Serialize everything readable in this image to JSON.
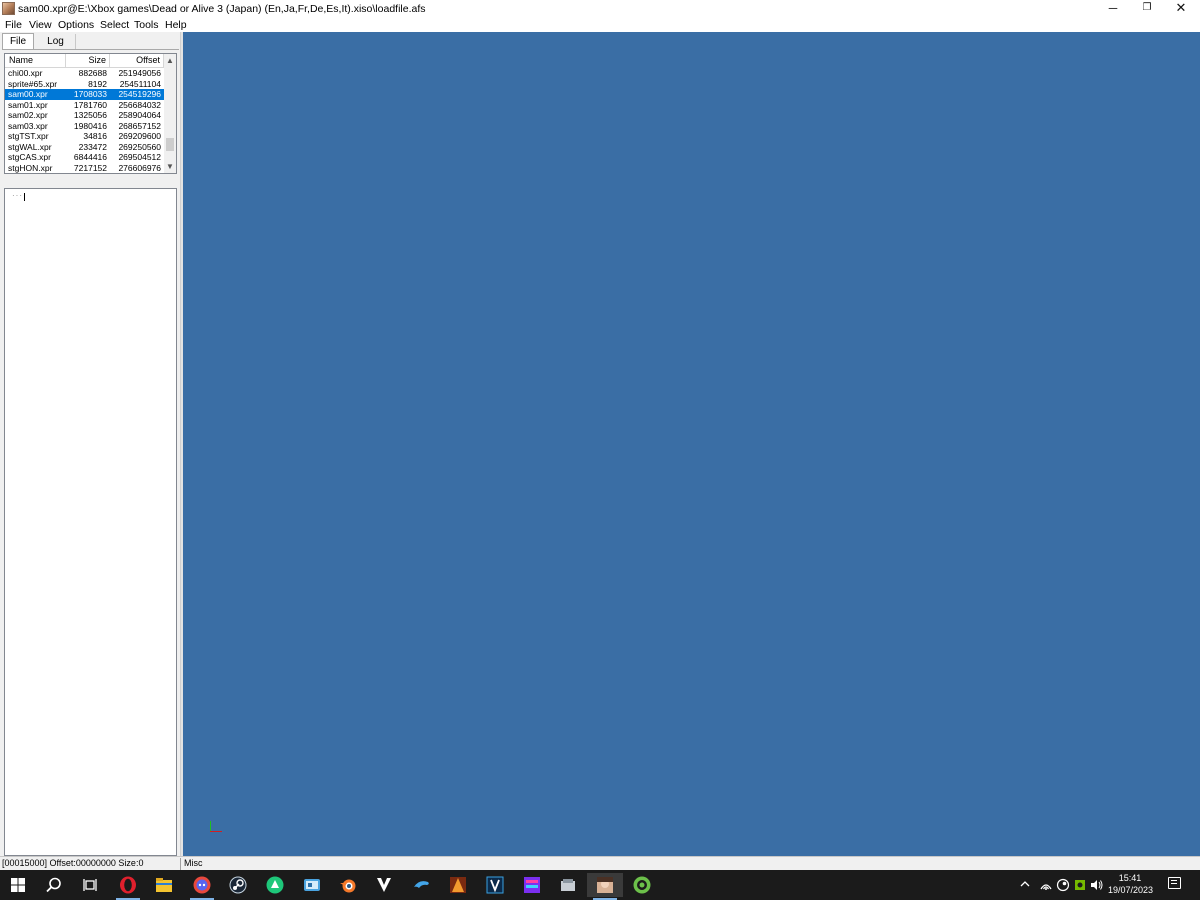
{
  "window": {
    "title": "sam00.xpr@E:\\Xbox games\\Dead or Alive 3 (Japan) (En,Ja,Fr,De,Es,It).xiso\\loadfile.afs",
    "minimize_glyph": "─",
    "maximize_glyph": "❐",
    "close_glyph": "✕"
  },
  "menu": [
    "File",
    "View",
    "Options",
    "Select",
    "Tools",
    "Help"
  ],
  "tabs": [
    {
      "label": "File",
      "active": true
    },
    {
      "label": "Log",
      "active": false
    }
  ],
  "file_list": {
    "columns": [
      "Name",
      "Size",
      "Offset"
    ],
    "rows": [
      {
        "name": "chi00.xpr",
        "size": "882688",
        "offset": "251949056",
        "selected": false
      },
      {
        "name": "sprite#65.xpr",
        "size": "8192",
        "offset": "254511104",
        "selected": false
      },
      {
        "name": "sam00.xpr",
        "size": "1708033",
        "offset": "254519296",
        "selected": true
      },
      {
        "name": "sam01.xpr",
        "size": "1781760",
        "offset": "256684032",
        "selected": false
      },
      {
        "name": "sam02.xpr",
        "size": "1325056",
        "offset": "258904064",
        "selected": false
      },
      {
        "name": "sam03.xpr",
        "size": "1980416",
        "offset": "268657152",
        "selected": false
      },
      {
        "name": "stgTST.xpr",
        "size": "34816",
        "offset": "269209600",
        "selected": false
      },
      {
        "name": "stgWAL.xpr",
        "size": "233472",
        "offset": "269250560",
        "selected": false
      },
      {
        "name": "stgCAS.xpr",
        "size": "6844416",
        "offset": "269504512",
        "selected": false
      },
      {
        "name": "stgHON.xpr",
        "size": "7217152",
        "offset": "276606976",
        "selected": false
      }
    ],
    "scroll_up_glyph": "▲",
    "scroll_down_glyph": "▼"
  },
  "tree": {
    "dots": "····"
  },
  "status": {
    "left": "[00015000] Offset:00000000 Size:0",
    "right": "Misc"
  },
  "colors": {
    "viewport_bg": "#3a6ea5",
    "selection": "#0078d7",
    "taskbar": "#1b1b1b"
  },
  "taskbar": {
    "icons": [
      "windows-start-icon",
      "search-icon",
      "task-view-icon",
      "opera-browser-icon",
      "file-explorer-icon",
      "discord-icon",
      "steam-icon",
      "app-green-icon",
      "app-blue-icon",
      "blender-icon",
      "vortex-icon",
      "dolphin-emulator-icon",
      "app-orange-icon",
      "vegas-icon",
      "hex-editor-icon",
      "app-gray-icon",
      "noesis-app-icon",
      "app-green-circle-icon"
    ],
    "time": "15:41",
    "date": "19/07/2023"
  }
}
